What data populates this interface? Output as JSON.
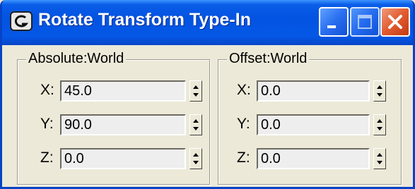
{
  "window": {
    "title": "Rotate Transform Type-In",
    "icons": {
      "app": "app-icon",
      "minimize": "minimize-icon",
      "maximize": "maximize-icon",
      "close": "close-icon"
    },
    "colors": {
      "titlebar": "#0353e1",
      "close_button": "#e25a2f",
      "face": "#ece9d8"
    }
  },
  "absolute": {
    "legend": "Absolute:World",
    "fields": [
      {
        "label": "X:",
        "value": "45.0"
      },
      {
        "label": "Y:",
        "value": "90.0"
      },
      {
        "label": "Z:",
        "value": "0.0"
      }
    ]
  },
  "offset": {
    "legend": "Offset:World",
    "fields": [
      {
        "label": "X:",
        "value": "0.0"
      },
      {
        "label": "Y:",
        "value": "0.0"
      },
      {
        "label": "Z:",
        "value": "0.0"
      }
    ]
  }
}
